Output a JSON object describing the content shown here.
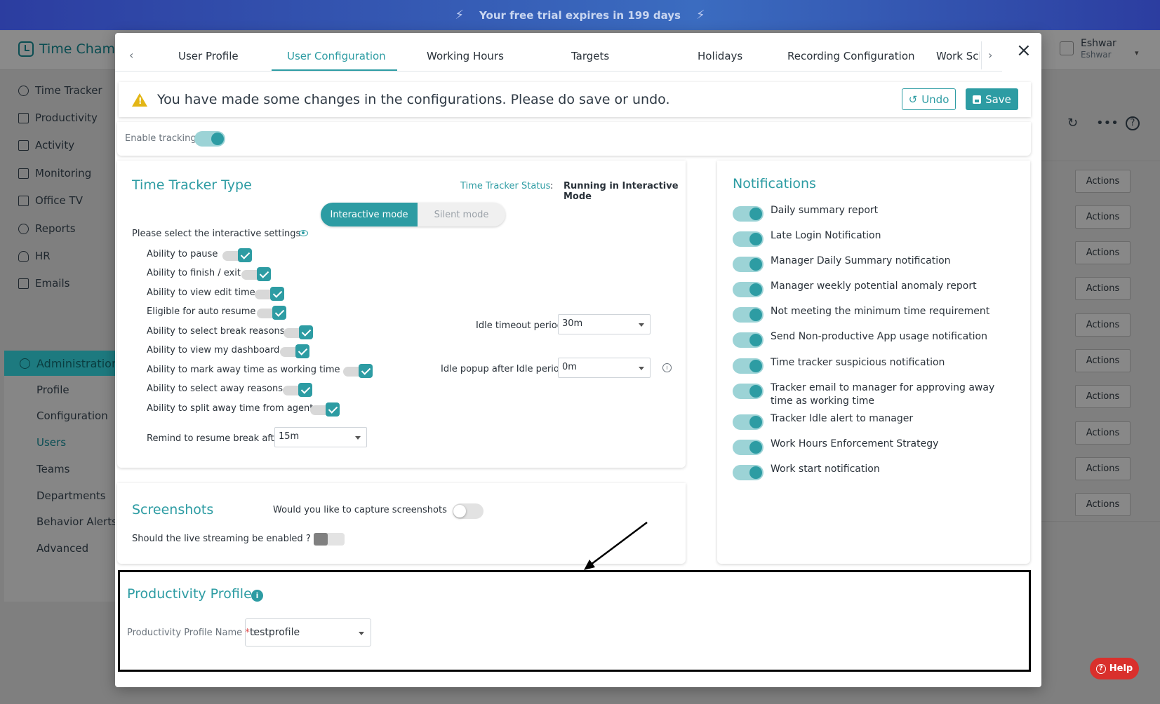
{
  "trial_banner": {
    "text": "Your free trial expires in 199 days"
  },
  "app": {
    "brand": "Time Champ",
    "user": {
      "name": "Eshwar",
      "sub": "Eshwar"
    },
    "sidebar": [
      {
        "label": "Time Tracker",
        "icon": "clock-icon"
      },
      {
        "label": "Productivity",
        "icon": "bar-chart-icon"
      },
      {
        "label": "Activity",
        "icon": "activity-icon"
      },
      {
        "label": "Monitoring",
        "icon": "monitor-icon"
      },
      {
        "label": "Office TV",
        "icon": "tv-icon"
      },
      {
        "label": "Reports",
        "icon": "pie-chart-icon"
      },
      {
        "label": "HR",
        "icon": "person-icon"
      },
      {
        "label": "Emails",
        "icon": "mail-icon"
      }
    ],
    "admin": {
      "label": "Administration",
      "sub": [
        "Profile",
        "Configuration",
        "Users",
        "Teams",
        "Departments",
        "Behavior Alerts",
        "Advanced"
      ],
      "active_sub": "Users"
    },
    "row_action_label": "Actions",
    "help_label": "Help"
  },
  "modal": {
    "tabs": [
      "User Profile",
      "User Configuration",
      "Working Hours",
      "Targets",
      "Holidays",
      "Recording Configuration",
      "Work Sche"
    ],
    "active_tab": "User Configuration",
    "warning": {
      "text": "You have made some changes in the configurations. Please do save or undo.",
      "undo": "Undo",
      "save": "Save",
      "color": "#e3b616"
    },
    "enable_tracking": {
      "label": "Enable tracking?",
      "on": true
    },
    "time_tracker": {
      "title": "Time Tracker Type",
      "status_label": "Time Tracker Status",
      "status_sep": ":",
      "status_value": "Running in Interactive Mode",
      "modes": [
        "Interactive mode",
        "Silent mode"
      ],
      "active_mode": "Interactive mode",
      "select_label": "Please select the interactive settings",
      "options": [
        "Ability to pause",
        "Ability to finish / exit",
        "Ability to view edit time",
        "Eligible for auto resume",
        "Ability to select break reasons",
        "Ability to view my dashboard",
        "Ability to mark away time as working time",
        "Ability to select away reasons",
        "Ability to split away time from agent"
      ],
      "idle_timeout": {
        "label": "Idle timeout period",
        "value": "30m"
      },
      "idle_popup": {
        "label": "Idle popup after Idle period",
        "value": "0m"
      },
      "remind": {
        "label": "Remind to resume break after",
        "value": "15m"
      }
    },
    "screenshots": {
      "title": "Screenshots",
      "capture_q": "Would you like to capture screenshots",
      "capture_on": false,
      "stream_q": "Should the live streaming be enabled ?",
      "stream_on": false
    },
    "notifications": {
      "title": "Notifications",
      "items": [
        "Daily summary report",
        "Late Login Notification",
        "Manager Daily Summary notification",
        "Manager weekly potential anomaly report",
        "Not meeting the minimum time requirement",
        "Send Non-productive App usage notification",
        "Time tracker suspicious notification",
        "Tracker email to manager for approving away time as working time",
        "Tracker Idle alert to manager",
        "Work Hours Enforcement Strategy",
        "Work start notification"
      ]
    },
    "productivity_profile": {
      "title": "Productivity Profile",
      "field_label": "Productivity Profile Name",
      "required_mark": "*",
      "field_sep": ":",
      "value": "testprofile"
    },
    "accent_color": "#2d9ca3"
  }
}
